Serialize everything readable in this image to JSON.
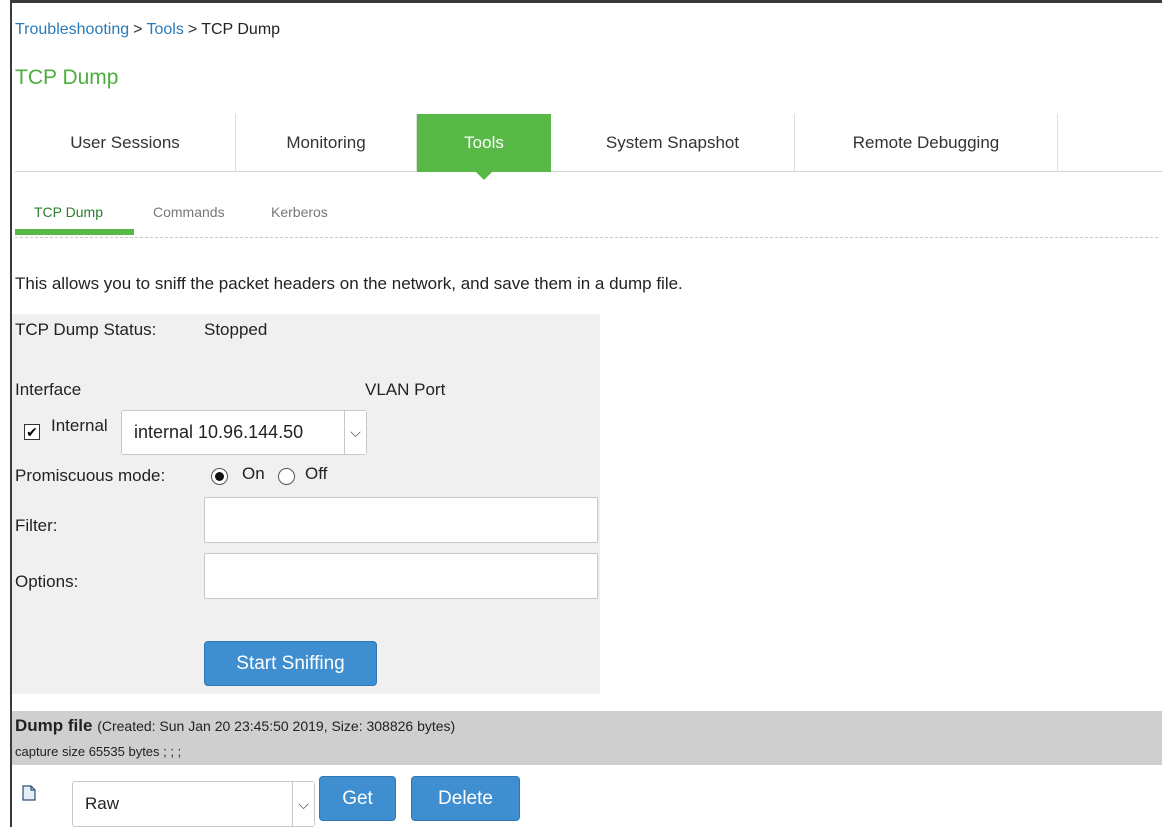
{
  "breadcrumb": {
    "items": [
      "Troubleshooting",
      "Tools"
    ],
    "separator": ">",
    "current": "TCP Dump"
  },
  "page_title": "TCP Dump",
  "tabs": [
    {
      "label": "User Sessions",
      "active": false
    },
    {
      "label": "Monitoring",
      "active": false
    },
    {
      "label": "Tools",
      "active": true
    },
    {
      "label": "System Snapshot",
      "active": false
    },
    {
      "label": "Remote Debugging",
      "active": false
    }
  ],
  "subtabs": [
    {
      "label": "TCP Dump",
      "active": true
    },
    {
      "label": "Commands",
      "active": false
    },
    {
      "label": "Kerberos",
      "active": false
    }
  ],
  "description": "This allows you to sniff the packet headers on the network, and save them in a dump file.",
  "form": {
    "status_label": "TCP Dump Status:",
    "status_value": "Stopped",
    "interface_label": "Interface",
    "vlan_label": "VLAN Port",
    "internal_label": "Internal",
    "internal_checked": true,
    "interface_selected": "internal 10.96.144.50",
    "promiscuous_label": "Promiscuous mode:",
    "promiscuous_on": "On",
    "promiscuous_off": "Off",
    "promiscuous_value": "On",
    "filter_label": "Filter:",
    "filter_value": "",
    "options_label": "Options:",
    "options_value": "",
    "start_button": "Start Sniffing"
  },
  "dump": {
    "title": "Dump file",
    "meta": "(Created: Sun Jan 20 23:45:50 2019, Size: 308826 bytes)",
    "capture": "capture size 65535 bytes ; ; ;",
    "format_selected": "Raw",
    "get_button": "Get",
    "delete_button": "Delete"
  },
  "colors": {
    "accent_green": "#58b947",
    "title_green": "#4cae3c",
    "link_blue": "#2a7ab8",
    "button_blue": "#3e8ed0"
  }
}
